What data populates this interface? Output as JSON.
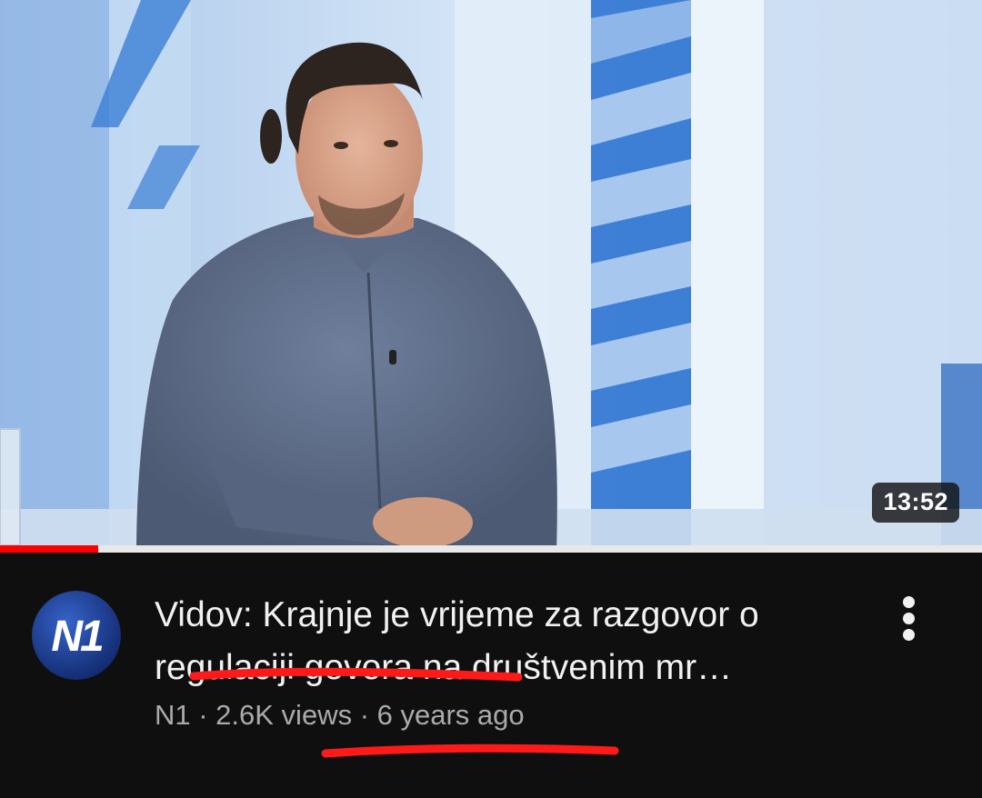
{
  "video": {
    "duration": "13:52",
    "watch_progress": 0.1,
    "title": "Vidov: Krajnje je vrijeme za razgovor o regulaciji govora na društvenim mr…",
    "channel_logo_text": "N1",
    "meta_line": "N1 · 2.6K views · 6 years ago"
  },
  "colors": {
    "background": "#0f0f0f",
    "progress": "#ff0000",
    "title_text": "#f1f1f1",
    "meta_text": "#aaaaaa",
    "annotation": "#ff1a1a",
    "logo_blue": "#1a3a8c"
  },
  "icons": {
    "menu": "more-vertical-icon"
  }
}
